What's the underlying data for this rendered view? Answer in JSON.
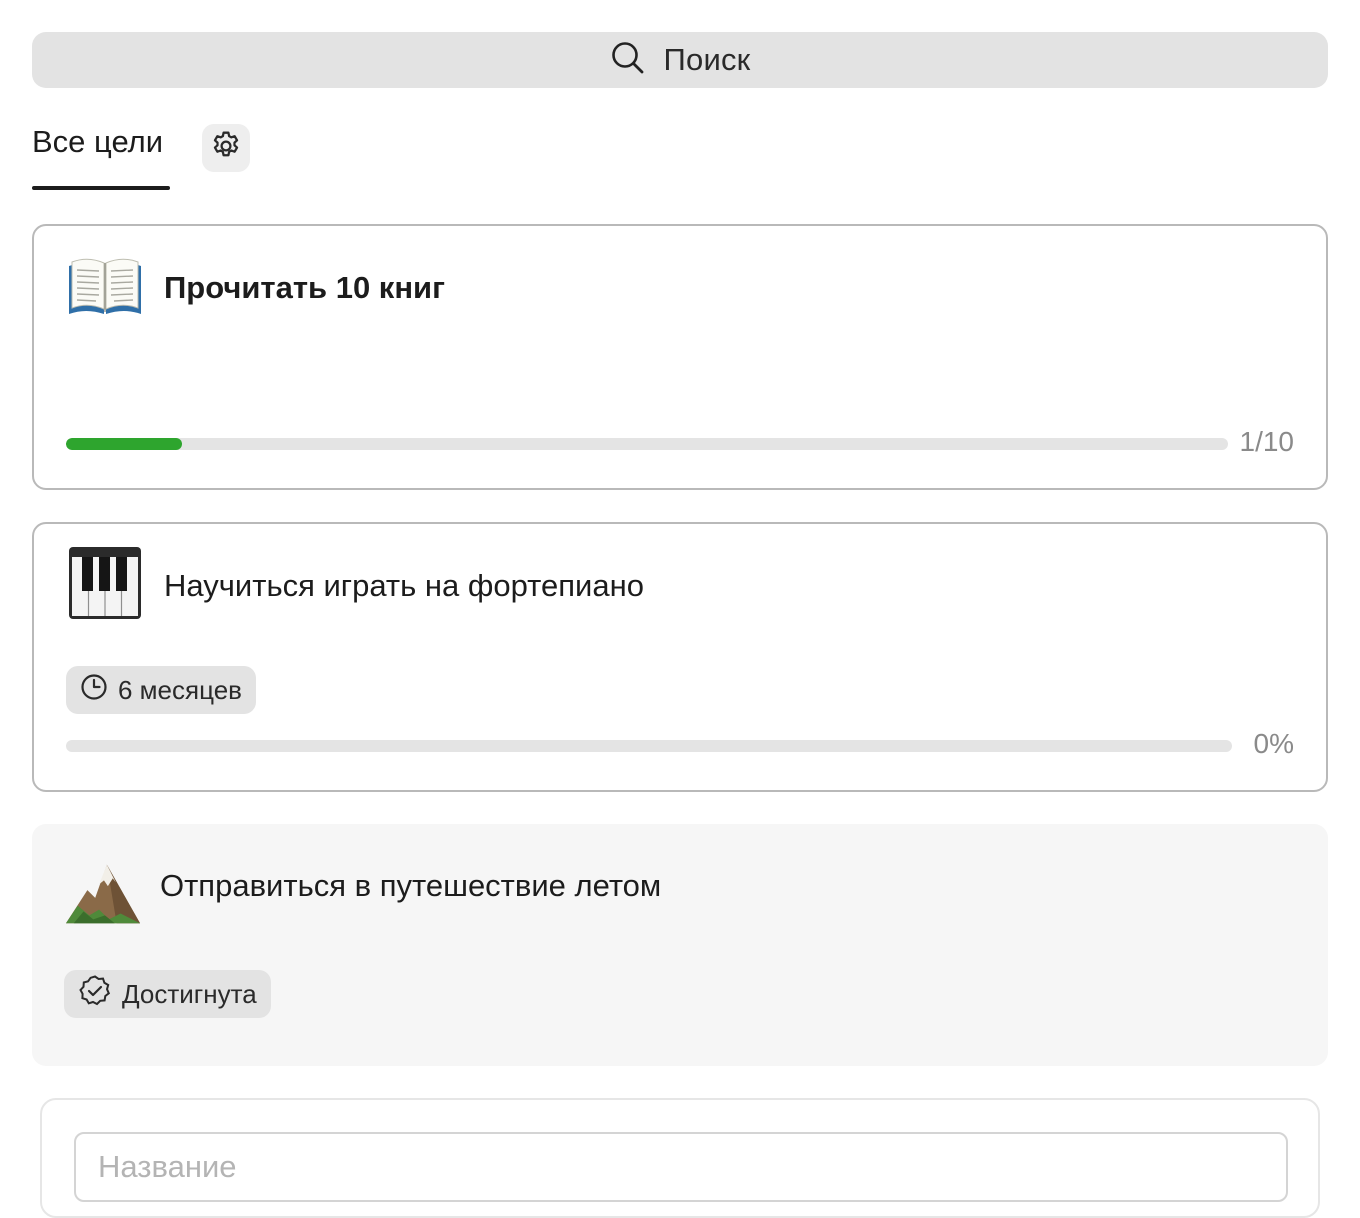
{
  "search": {
    "label": "Поиск",
    "icon": "search-icon"
  },
  "tabs": {
    "active": "Все цели",
    "settings_icon": "gear-icon"
  },
  "goals": [
    {
      "emoji": "book-icon",
      "title": "Прочитать 10 книг",
      "progress_text": "1/10",
      "progress_fraction": 0.1,
      "progress_color": "#2ea52e",
      "status": "in-progress"
    },
    {
      "emoji": "piano-keys-icon",
      "title": "Научиться играть на фортепиано",
      "deadline_chip": "6 месяцев",
      "deadline_icon": "clock-icon",
      "progress_text": "0%",
      "progress_fraction": 0,
      "status": "in-progress"
    },
    {
      "emoji": "mountain-icon",
      "title": "Отправиться в путешествие летом",
      "status_chip": "Достигнута",
      "status_icon": "check-badge-icon",
      "status": "achieved"
    }
  ],
  "new_goal": {
    "placeholder": "Название"
  },
  "colors": {
    "search_bg": "#e3e3e3",
    "progress_fill": "#2ea52e",
    "progress_track": "#e4e4e4",
    "achieved_bg": "#f6f6f6"
  }
}
